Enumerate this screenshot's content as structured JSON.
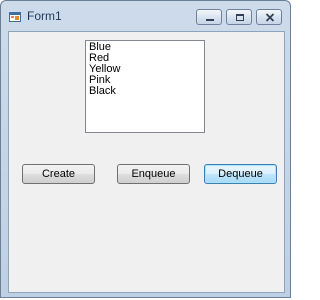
{
  "window": {
    "title": "Form1",
    "icons": {
      "app": "form-app-icon",
      "minimize": "minimize-icon",
      "maximize": "maximize-icon",
      "close": "close-icon"
    }
  },
  "listbox": {
    "items": [
      "Blue",
      "Red",
      "Yellow",
      "Pink",
      "Black"
    ]
  },
  "buttons": {
    "create": "Create",
    "enqueue": "Enqueue",
    "dequeue": "Dequeue"
  },
  "colors": {
    "frame": "#bed0e4",
    "client_background": "#f0f0f0",
    "focused_button_border": "#3c7fb1"
  }
}
